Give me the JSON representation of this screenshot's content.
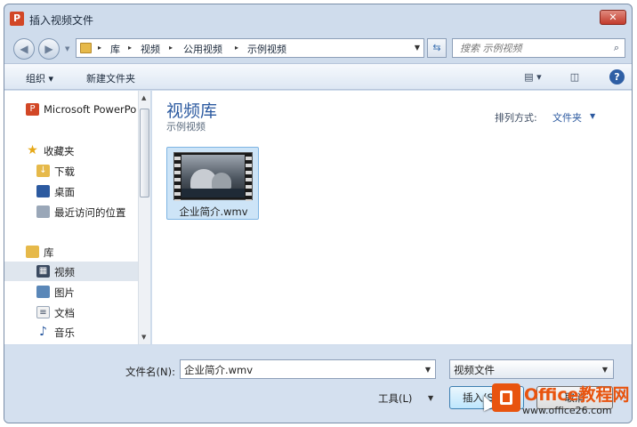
{
  "window": {
    "title": "插入视频文件",
    "close_symbol": "✕"
  },
  "address_bar": {
    "crumbs": [
      "库",
      "视频",
      "公用视频",
      "示例视频"
    ],
    "separator": "▸"
  },
  "search": {
    "placeholder": "搜索 示例视频"
  },
  "toolbar": {
    "organize": "组织 ▾",
    "new_folder": "新建文件夹",
    "help": "?"
  },
  "sidebar": {
    "items": [
      {
        "label": "Microsoft PowerPoint",
        "icon": "powerpoint-icon"
      },
      {
        "label": "收藏夹",
        "icon": "star-icon"
      },
      {
        "label": "下载",
        "icon": "download-folder-icon"
      },
      {
        "label": "桌面",
        "icon": "desktop-icon"
      },
      {
        "label": "最近访问的位置",
        "icon": "recent-places-icon"
      },
      {
        "label": "库",
        "icon": "libraries-icon"
      },
      {
        "label": "视频",
        "icon": "video-library-icon",
        "selected": true
      },
      {
        "label": "图片",
        "icon": "pictures-icon"
      },
      {
        "label": "文档",
        "icon": "documents-icon"
      },
      {
        "label": "音乐",
        "icon": "music-icon"
      }
    ]
  },
  "content": {
    "library_title": "视频库",
    "library_subtitle": "示例视频",
    "arrange_label": "排列方式:",
    "arrange_value": "文件夹",
    "files": [
      {
        "name": "企业简介.wmv",
        "selected": true
      }
    ]
  },
  "bottom": {
    "filename_label": "文件名(N):",
    "filename_value": "企业简介.wmv",
    "filetype_value": "视频文件",
    "tools_label": "工具(L)",
    "insert_label": "插入(S)",
    "cancel_label": "取消"
  },
  "watermark": {
    "title": "Office教程网",
    "url": "www.office26.com"
  },
  "colors": {
    "accent": "#2c5aa0",
    "selection": "#cde4f7",
    "watermark": "#e8540f"
  }
}
